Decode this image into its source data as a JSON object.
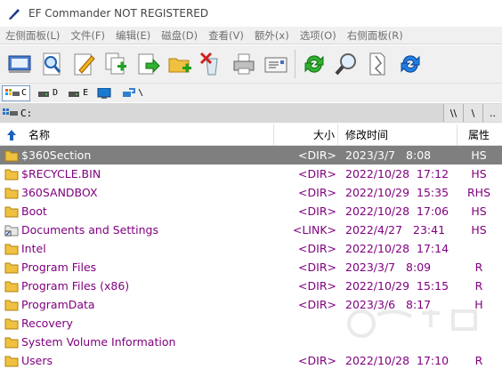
{
  "window": {
    "title": "EF Commander NOT REGISTERED"
  },
  "menu": [
    "左侧面板(L)",
    "文件(F)",
    "编辑(E)",
    "磁盘(D)",
    "查看(V)",
    "额外(x)",
    "选项(O)",
    "右侧面板(R)"
  ],
  "toolbar": {
    "buttons": [
      "drive-list",
      "find-files",
      "edit-file",
      "copy-files",
      "move-files",
      "new-folder",
      "delete",
      "print",
      "email",
      "refresh-left",
      "search",
      "compare",
      "refresh-right"
    ]
  },
  "drives": [
    {
      "label": "C",
      "active": true
    },
    {
      "label": "D",
      "active": false
    },
    {
      "label": "E",
      "active": false
    },
    {
      "label": "",
      "active": false
    },
    {
      "label": "\\",
      "active": false
    }
  ],
  "path": {
    "text": "C:",
    "buttons": [
      "\\\\",
      "\\",
      ".."
    ]
  },
  "columns": {
    "name": "名称",
    "size": "大小",
    "date": "修改时间",
    "attr": "属性"
  },
  "files": [
    {
      "name": "$360Section",
      "size": "<DIR>",
      "date": "2023/3/7   8:08",
      "attr": "HS",
      "icon": "folder",
      "selected": true
    },
    {
      "name": "$RECYCLE.BIN",
      "size": "<DIR>",
      "date": "2022/10/28  17:12",
      "attr": "HS",
      "icon": "folder",
      "selected": false
    },
    {
      "name": "360SANDBOX",
      "size": "<DIR>",
      "date": "2022/10/29  15:35",
      "attr": "RHS",
      "icon": "folder",
      "selected": false
    },
    {
      "name": "Boot",
      "size": "<DIR>",
      "date": "2022/10/28  17:06",
      "attr": "HS",
      "icon": "folder",
      "selected": false
    },
    {
      "name": "Documents and Settings",
      "size": "<LINK>",
      "date": "2022/4/27   23:41",
      "attr": "HS",
      "icon": "link",
      "selected": false
    },
    {
      "name": "Intel",
      "size": "<DIR>",
      "date": "2022/10/28  17:14",
      "attr": "",
      "icon": "folder",
      "selected": false
    },
    {
      "name": "Program Files",
      "size": "<DIR>",
      "date": "2023/3/7   8:09",
      "attr": "R",
      "icon": "folder",
      "selected": false
    },
    {
      "name": "Program Files (x86)",
      "size": "<DIR>",
      "date": "2022/10/29  15:15",
      "attr": "R",
      "icon": "folder",
      "selected": false
    },
    {
      "name": "ProgramData",
      "size": "<DIR>",
      "date": "2023/3/6   8:17",
      "attr": "H",
      "icon": "folder",
      "selected": false
    },
    {
      "name": "Recovery",
      "size": "",
      "date": "",
      "attr": "",
      "icon": "folder",
      "selected": false
    },
    {
      "name": "System Volume Information",
      "size": "",
      "date": "",
      "attr": "",
      "icon": "folder",
      "selected": false
    },
    {
      "name": "Users",
      "size": "<DIR>",
      "date": "2022/10/28  17:10",
      "attr": "R",
      "icon": "folder",
      "selected": false
    }
  ],
  "colors": {
    "file_text": "#80007f",
    "selected_bg": "#7f7f7f",
    "menu_text": "#707070",
    "folder": "#f0c040"
  }
}
